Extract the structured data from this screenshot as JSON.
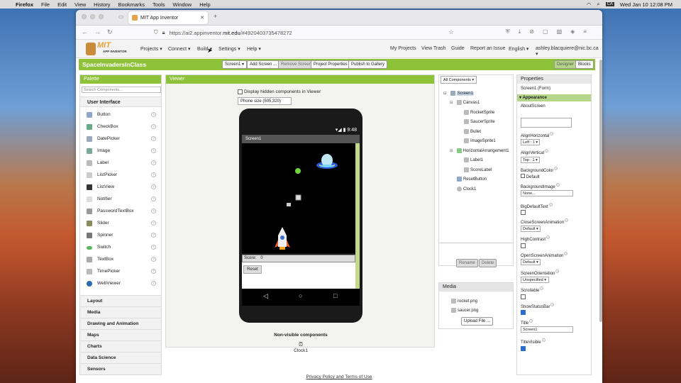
{
  "menubar": {
    "app": "Firefox",
    "items": [
      "File",
      "Edit",
      "View",
      "History",
      "Bookmarks",
      "Tools",
      "Window",
      "Help"
    ],
    "input_indicator": "CA",
    "clock": "Wed Jan 10  12:08 PM"
  },
  "browser": {
    "tab_title": "MIT App Inventor",
    "url_prefix": "https://ai2.appinventor.",
    "url_host": "mit.edu",
    "url_rest": "/#4920403735478272"
  },
  "appinventor": {
    "logo_text": "MIT",
    "logo_sub": "APP INVENTOR",
    "top_menu": [
      "Projects ▾",
      "Connect ▾",
      "Build ▾",
      "Settings ▾",
      "Help ▾"
    ],
    "right_menu": [
      "My Projects",
      "View Trash",
      "Guide",
      "Report an Issue",
      "English ▾",
      "ashley.blacquiere@nic.bc.ca ▾"
    ],
    "project_name": "SpaceInvadersInClass",
    "toolbar": {
      "screen_select": "Screen1 ▾",
      "add_screen": "Add Screen ...",
      "remove_screen": "Remove Screen",
      "project_properties": "Project Properties",
      "publish": "Publish to Gallery",
      "designer": "Designer",
      "blocks": "Blocks"
    },
    "palette": {
      "title": "Palette",
      "search_placeholder": "Search Components...",
      "section": "User Interface",
      "items": [
        "Button",
        "CheckBox",
        "DatePicker",
        "Image",
        "Label",
        "ListPicker",
        "ListView",
        "Notifier",
        "PasswordTextBox",
        "Slider",
        "Spinner",
        "Switch",
        "TextBox",
        "TimePicker",
        "WebViewer"
      ],
      "help": "?",
      "categories": [
        "Layout",
        "Media",
        "Drawing and Animation",
        "Maps",
        "Charts",
        "Data Science",
        "Sensors"
      ]
    },
    "viewer": {
      "title": "Viewer",
      "hidden_checkbox": "Display hidden components in Viewer",
      "phone_size": "Phone size (505,320)",
      "status_time": "9:48",
      "screen_title": "Screen1",
      "score_label": "Score:",
      "score_value": "0",
      "reset_button": "Reset",
      "nav_back": "◁",
      "nav_home": "○",
      "nav_recent": "□",
      "nonvisible_title": "Non-visible components",
      "nonvisible_item": "Clock1"
    },
    "components": {
      "dropdown": "All Components ▾",
      "tree": [
        "Screen1",
        "Canvas1",
        "RocketSprite",
        "SaucerSprite",
        "Bullet",
        "ImageSprite1",
        "HorizontalArrangement1",
        "Label1",
        "ScoreLabel",
        "ResetButton",
        "Clock1"
      ],
      "rename": "Rename",
      "delete": "Delete"
    },
    "media": {
      "title": "Media",
      "files": [
        "rocket.png",
        "saucer.png"
      ],
      "upload": "Upload File ..."
    },
    "properties": {
      "title": "Properties",
      "subtitle": "Screen1 (Form)",
      "section": "Appearance",
      "about_screen": "AboutScreen",
      "align_horizontal": "AlignHorizontal",
      "align_horizontal_value": "Left : 1 ▾",
      "align_vertical": "AlignVertical",
      "align_vertical_value": "Top : 1 ▾",
      "background_color": "BackgroundColor",
      "background_color_value": "Default",
      "background_image": "BackgroundImage",
      "background_image_value": "None...",
      "big_default_text": "BigDefaultText",
      "close_anim": "CloseScreenAnimation",
      "close_anim_value": "Default ▾",
      "high_contrast": "HighContrast",
      "open_anim": "OpenScreenAnimation",
      "open_anim_value": "Default ▾",
      "orientation": "ScreenOrientation",
      "orientation_value": "Unspecified ▾",
      "scrollable": "Scrollable",
      "show_status_bar": "ShowStatusBar",
      "title_label": "Title",
      "title_value": "Screen1",
      "title_visible": "TitleVisible",
      "help": "?"
    },
    "footer": "Privacy Policy and Terms of Use"
  }
}
